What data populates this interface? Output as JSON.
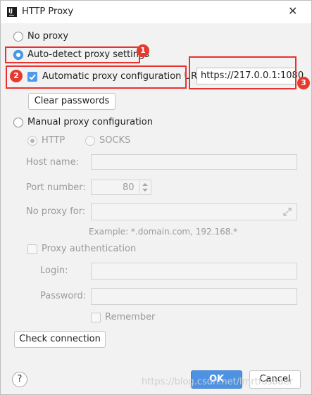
{
  "window": {
    "title": "HTTP Proxy",
    "app_icon_text": "IJ"
  },
  "proxy_mode": {
    "no_proxy": "No proxy",
    "auto_detect": "Auto-detect proxy settings",
    "auto_config_url_label": "Automatic proxy configuration URL",
    "auto_config_url_value": "https://217.0.0.1:1080",
    "clear_passwords": "Clear passwords",
    "manual": "Manual proxy configuration"
  },
  "manual": {
    "http": "HTTP",
    "socks": "SOCKS",
    "host_name": "Host name:",
    "port_number": "Port number:",
    "port_value": "80",
    "no_proxy_for": "No proxy for:",
    "example": "Example: *.domain.com, 192.168.*",
    "proxy_auth": "Proxy authentication",
    "login": "Login:",
    "password": "Password:",
    "remember": "Remember"
  },
  "buttons": {
    "check_connection": "Check connection",
    "help": "?",
    "ok": "OK",
    "cancel": "Cancel"
  },
  "annotations": {
    "badge1": "1",
    "badge2": "2",
    "badge3": "3"
  },
  "watermark": "https://blog.csdn.net/lmrtfusbaer"
}
